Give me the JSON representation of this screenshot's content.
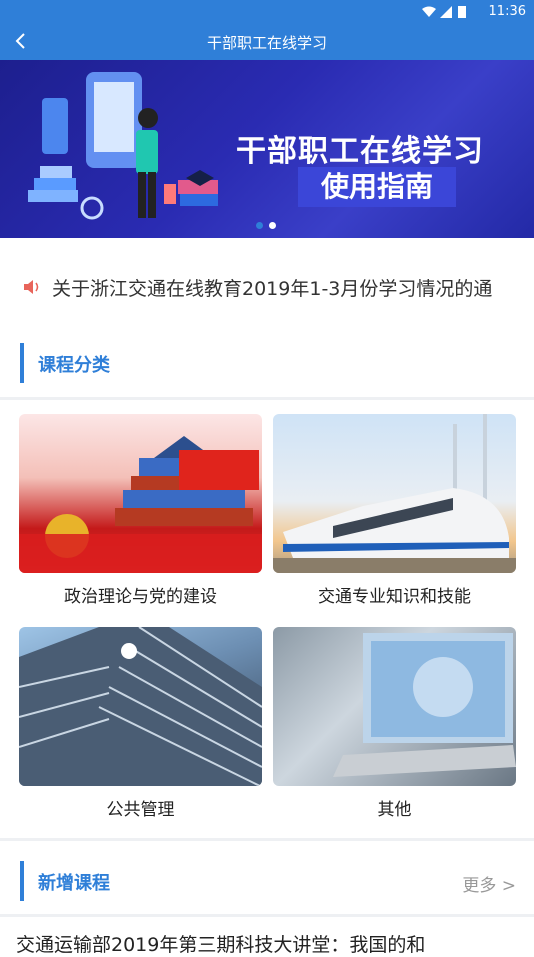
{
  "status_bar": {
    "time": "11:36"
  },
  "header": {
    "title": "干部职工在线学习"
  },
  "banner": {
    "headline": "干部职工在线学习",
    "subtitle": "使用指南",
    "colors": {
      "dot_active": "#2f7fd8",
      "dot_inactive": "#ffffff"
    }
  },
  "notice": {
    "text": "关于浙江交通在线教育2019年1-3月份学习情况的通"
  },
  "course_category": {
    "title": "课程分类",
    "items": [
      {
        "label": "政治理论与党的建设"
      },
      {
        "label": "交通专业知识和技能"
      },
      {
        "label": "公共管理"
      },
      {
        "label": "其他"
      }
    ]
  },
  "new_courses": {
    "title": "新增课程",
    "more_label": "更多 >",
    "first_item": "交通运输部2019年第三期科技大讲堂：我国的和"
  },
  "colors": {
    "accent": "#2f7fd8",
    "divider": "#eef0f3",
    "muted": "#999999"
  }
}
